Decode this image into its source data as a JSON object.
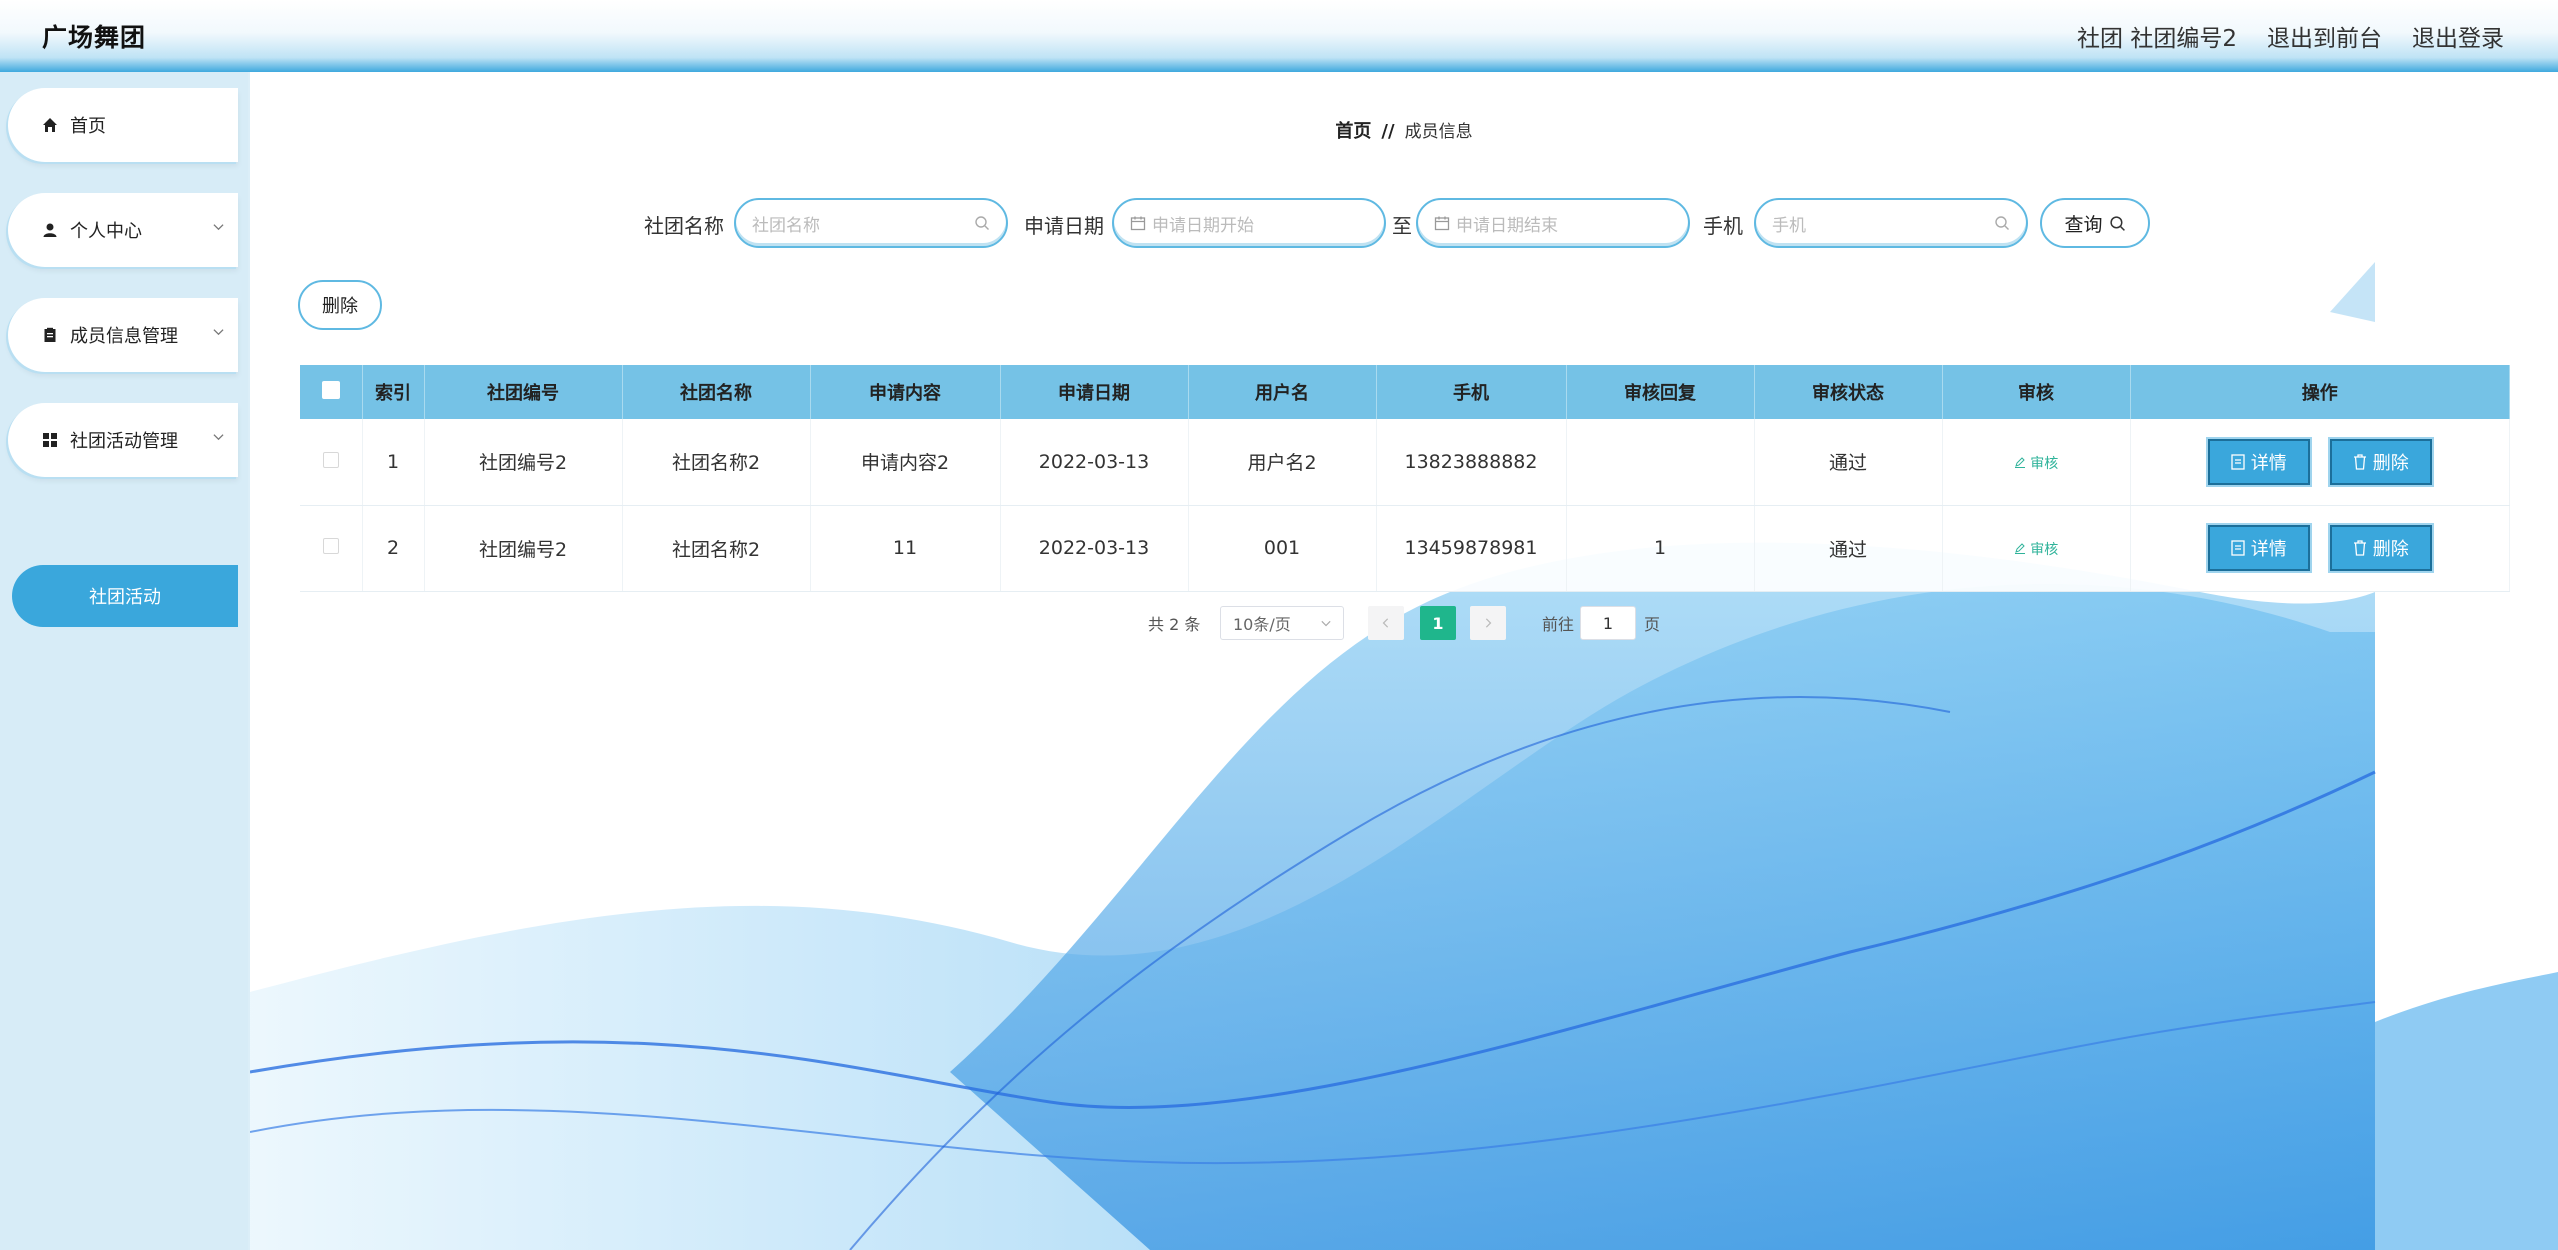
{
  "header": {
    "brand": "广场舞团",
    "user": "社团 社团编号2",
    "to_front": "退出到前台",
    "logout": "退出登录"
  },
  "sidebar": {
    "items": [
      {
        "label": "首页",
        "icon": "home-icon"
      },
      {
        "label": "个人中心",
        "icon": "user-icon"
      },
      {
        "label": "成员信息管理",
        "icon": "clipboard-icon"
      },
      {
        "label": "社团活动管理",
        "icon": "grid-icon"
      }
    ],
    "active_label": "社团活动"
  },
  "breadcrumb": {
    "home": "首页",
    "separator": "//",
    "current": "成员信息"
  },
  "search": {
    "club_name_label": "社团名称",
    "club_name_placeholder": "社团名称",
    "date_label": "申请日期",
    "date_start_placeholder": "申请日期开始",
    "date_to": "至",
    "date_end_placeholder": "申请日期结束",
    "phone_label": "手机",
    "phone_placeholder": "手机",
    "query_button": "查询"
  },
  "toolbar": {
    "delete_button": "删除"
  },
  "table": {
    "headers": [
      "索引",
      "社团编号",
      "社团名称",
      "申请内容",
      "申请日期",
      "用户名",
      "手机",
      "审核回复",
      "审核状态",
      "审核",
      "操作"
    ],
    "rows": [
      {
        "index": "1",
        "club_no": "社团编号2",
        "club_name": "社团名称2",
        "content": "申请内容2",
        "date": "2022-03-13",
        "username": "用户名2",
        "phone": "13823888882",
        "reply": "",
        "status": "通过",
        "audit": "审核",
        "detail": "详情",
        "delete": "删除"
      },
      {
        "index": "2",
        "club_no": "社团编号2",
        "club_name": "社团名称2",
        "content": "11",
        "date": "2022-03-13",
        "username": "001",
        "phone": "13459878981",
        "reply": "1",
        "status": "通过",
        "audit": "审核",
        "detail": "详情",
        "delete": "删除"
      }
    ]
  },
  "pagination": {
    "total": "共 2 条",
    "page_size": "10条/页",
    "current_page": "1",
    "goto_label": "前往",
    "goto_value": "1",
    "page_suffix": "页"
  },
  "colors": {
    "accent": "#3aa7dc",
    "header_row": "#75c2e6",
    "active_page": "#1fb68c"
  }
}
